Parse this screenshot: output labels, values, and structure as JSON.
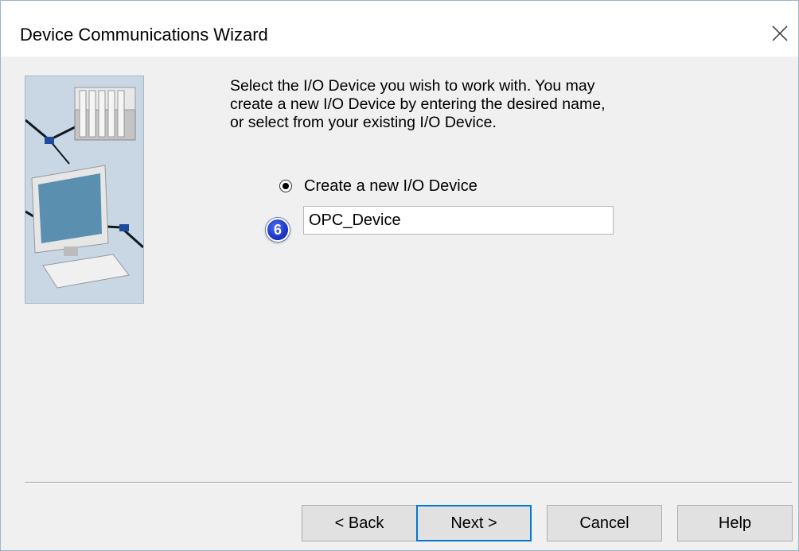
{
  "window": {
    "title": "Device Communications Wizard",
    "close_icon": "close-icon"
  },
  "instructions": {
    "lines": [
      "Select the I/O Device you wish to work with. You may",
      "create a new I/O Device by entering the desired name,",
      "or select from your existing I/O Device."
    ]
  },
  "option": {
    "label": "Create a new I/O Device",
    "selected": true
  },
  "device_name": {
    "value": "OPC_Device"
  },
  "step_badge": "6",
  "buttons": {
    "back": "< Back",
    "next": "Next >",
    "cancel": "Cancel",
    "help": "Help"
  },
  "colors": {
    "accent": "#0078d7",
    "badge": "#1c35c8",
    "illustration_bg": "#c9d6e4"
  }
}
